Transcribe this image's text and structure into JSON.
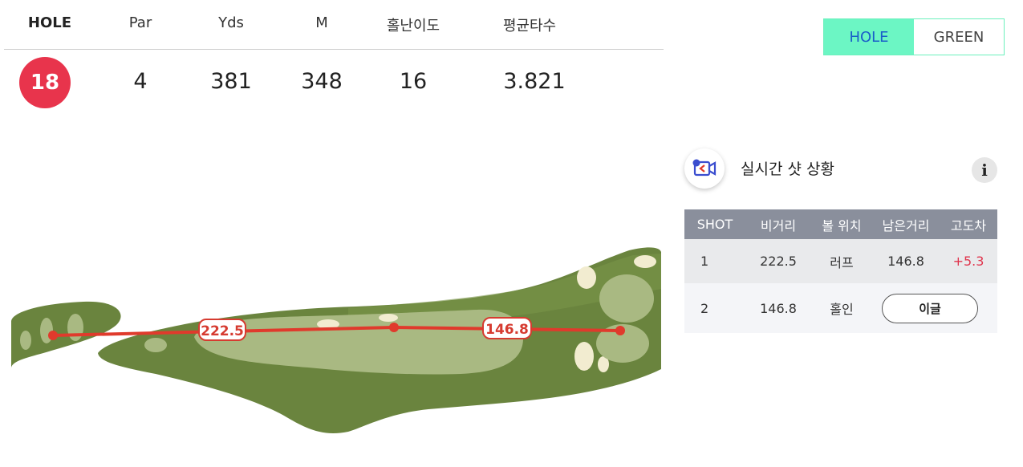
{
  "hole_info": {
    "headers": [
      "HOLE",
      "Par",
      "Yds",
      "M",
      "홀난이도",
      "평균타수"
    ],
    "hole": "18",
    "par": "4",
    "yds": "381",
    "m": "348",
    "difficulty": "16",
    "avg_score": "3.821"
  },
  "toggle": {
    "hole_label": "HOLE",
    "green_label": "GREEN"
  },
  "map": {
    "labels": [
      "222.5",
      "146.8"
    ]
  },
  "live": {
    "title": "실시간 샷 상황",
    "info": "i"
  },
  "shot_table": {
    "headers": [
      "SHOT",
      "비거리",
      "볼 위치",
      "남은거리",
      "고도차"
    ],
    "rows": [
      {
        "shot": "1",
        "distance": "222.5",
        "position": "러프",
        "remaining": "146.8",
        "elevation": "+5.3"
      },
      {
        "shot": "2",
        "distance": "146.8",
        "position": "홀인",
        "action": "이글"
      }
    ]
  },
  "colors": {
    "accent_red": "#e8344c",
    "toggle_active_bg": "#6cf6c4",
    "toggle_active_text": "#1a5fc9",
    "fairway": "#a9b982",
    "rough": "#6a843e",
    "shot_line": "#e03a2c"
  }
}
